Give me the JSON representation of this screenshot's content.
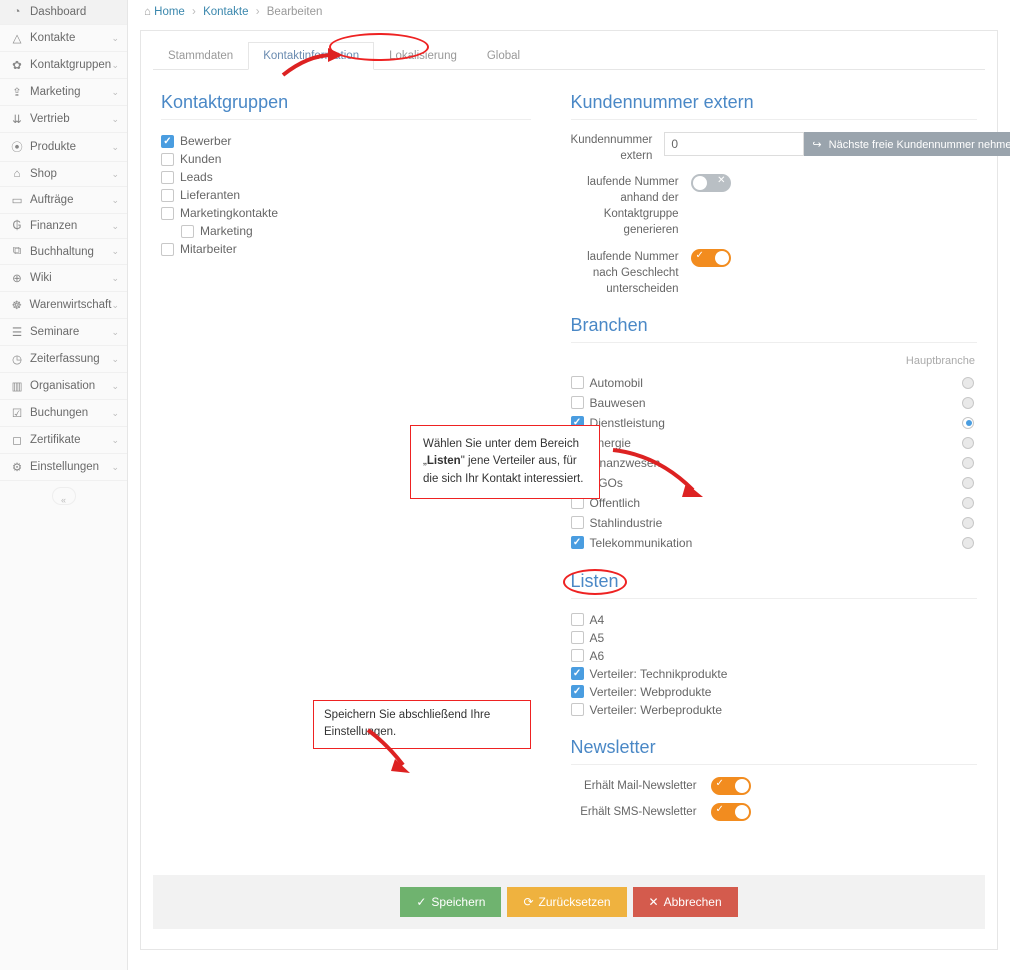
{
  "breadcrumb": {
    "home": "Home",
    "kontakte": "Kontakte",
    "bearbeiten": "Bearbeiten"
  },
  "sidebar": {
    "items": [
      {
        "icon": "◔",
        "label": "Dashboard",
        "chev": ""
      },
      {
        "icon": "△",
        "label": "Kontakte",
        "chev": "⌄"
      },
      {
        "icon": "✿",
        "label": "Kontaktgruppen",
        "chev": "⌄"
      },
      {
        "icon": "⇪",
        "label": "Marketing",
        "chev": "⌄"
      },
      {
        "icon": "⇊",
        "label": "Vertrieb",
        "chev": "⌄"
      },
      {
        "icon": "⦿",
        "label": "Produkte",
        "chev": "⌄"
      },
      {
        "icon": "⌂",
        "label": "Shop",
        "chev": "⌄"
      },
      {
        "icon": "▭",
        "label": "Aufträge",
        "chev": "⌄"
      },
      {
        "icon": "₲",
        "label": "Finanzen",
        "chev": "⌄"
      },
      {
        "icon": "⧉",
        "label": "Buchhaltung",
        "chev": "⌄"
      },
      {
        "icon": "⊕",
        "label": "Wiki",
        "chev": "⌄"
      },
      {
        "icon": "☸",
        "label": "Warenwirtschaft",
        "chev": "⌄"
      },
      {
        "icon": "☰",
        "label": "Seminare",
        "chev": "⌄"
      },
      {
        "icon": "◷",
        "label": "Zeiterfassung",
        "chev": "⌄"
      },
      {
        "icon": "▥",
        "label": "Organisation",
        "chev": "⌄"
      },
      {
        "icon": "☑",
        "label": "Buchungen",
        "chev": "⌄"
      },
      {
        "icon": "◻",
        "label": "Zertifikate",
        "chev": "⌄"
      },
      {
        "icon": "⚙",
        "label": "Einstellungen",
        "chev": "⌄"
      }
    ]
  },
  "tabs": [
    "Stammdaten",
    "Kontaktinformation",
    "Lokalisierung",
    "Global"
  ],
  "sections": {
    "kontaktgruppen": "Kontaktgruppen",
    "kundennummer": "Kundennummer extern",
    "branchen": "Branchen",
    "listen": "Listen",
    "newsletter": "Newsletter"
  },
  "kontaktgruppen": [
    {
      "label": "Bewerber",
      "checked": true,
      "indent": false
    },
    {
      "label": "Kunden",
      "checked": false,
      "indent": false
    },
    {
      "label": "Leads",
      "checked": false,
      "indent": false
    },
    {
      "label": "Lieferanten",
      "checked": false,
      "indent": false
    },
    {
      "label": "Marketingkontakte",
      "checked": false,
      "indent": false
    },
    {
      "label": "Marketing",
      "checked": false,
      "indent": true
    },
    {
      "label": "Mitarbeiter",
      "checked": false,
      "indent": false
    }
  ],
  "kundennummer_form": {
    "label": "Kundennummer extern",
    "value": "0",
    "button": "Nächste freie Kundennummer nehmen",
    "row2_label": "laufende Nummer anhand der Kontaktgruppe generieren",
    "row3_label": "laufende Nummer nach Geschlecht unterscheiden"
  },
  "branchen": {
    "header": "Hauptbranche",
    "items": [
      {
        "label": "Automobil",
        "checked": false,
        "radio": false
      },
      {
        "label": "Bauwesen",
        "checked": false,
        "radio": false
      },
      {
        "label": "Dienstleistung",
        "checked": true,
        "radio": true
      },
      {
        "label": "Energie",
        "checked": false,
        "radio": false
      },
      {
        "label": "Finanzwesen",
        "checked": false,
        "radio": false
      },
      {
        "label": "NGOs",
        "checked": false,
        "radio": false
      },
      {
        "label": "Öffentlich",
        "checked": false,
        "radio": false
      },
      {
        "label": "Stahlindustrie",
        "checked": false,
        "radio": false
      },
      {
        "label": "Telekommunikation",
        "checked": true,
        "radio": false
      }
    ]
  },
  "listen": [
    {
      "label": "A4",
      "checked": false
    },
    {
      "label": "A5",
      "checked": false
    },
    {
      "label": "A6",
      "checked": false
    },
    {
      "label": "Verteiler: Technikprodukte",
      "checked": true
    },
    {
      "label": "Verteiler: Webprodukte",
      "checked": true
    },
    {
      "label": "Verteiler: Werbeprodukte",
      "checked": false
    }
  ],
  "newsletter": {
    "mail": "Erhält Mail-Newsletter",
    "sms": "Erhält SMS-Newsletter"
  },
  "hints": {
    "listen_pre": "Wählen Sie unter dem Bereich „",
    "listen_bold": "Listen",
    "listen_post": "\" jene Verteiler aus, für die sich Ihr Kontakt interessiert.",
    "save": "Speichern Sie abschließend Ihre Einstellungen."
  },
  "buttons": {
    "save": "Speichern",
    "reset": "Zurücksetzen",
    "cancel": "Abbrechen"
  }
}
